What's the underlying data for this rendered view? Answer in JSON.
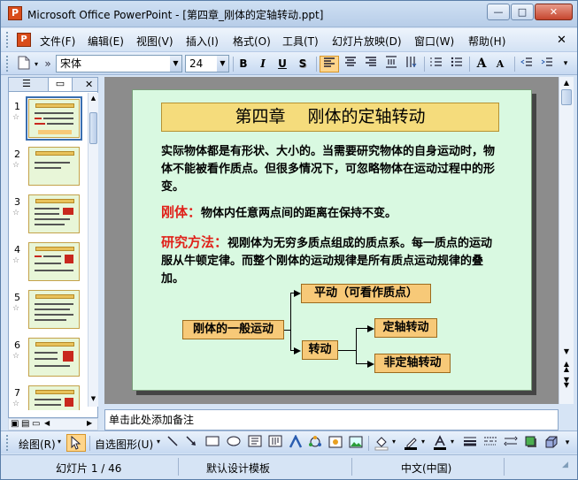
{
  "window": {
    "app_icon": "P",
    "title": "Microsoft Office PowerPoint - [第四章_刚体的定轴转动.ppt]",
    "buttons": {
      "minimize": "—",
      "maximize": "□",
      "close": "✕"
    }
  },
  "menubar": {
    "doc_icon": "P",
    "items": [
      "文件(F)",
      "编辑(E)",
      "视图(V)",
      "插入(I)",
      "格式(O)",
      "工具(T)",
      "幻灯片放映(D)",
      "窗口(W)",
      "帮助(H)"
    ],
    "close_glyph": "✕"
  },
  "toolbar": {
    "font_name": "宋体",
    "font_size": "24",
    "bold": "B",
    "italic": "I",
    "underline": "U",
    "shadow": "S",
    "increase_font": "A",
    "decrease_font": "A"
  },
  "left_pane": {
    "tab_outline_glyph": "☰",
    "tab_slides_glyph": "▭",
    "close_glyph": "✕",
    "thumbnails": [
      {
        "num": "1",
        "star": "☆"
      },
      {
        "num": "2",
        "star": "☆"
      },
      {
        "num": "3",
        "star": "☆"
      },
      {
        "num": "4",
        "star": "☆"
      },
      {
        "num": "5",
        "star": "☆"
      },
      {
        "num": "6",
        "star": "☆"
      },
      {
        "num": "7",
        "star": "☆"
      }
    ]
  },
  "slide": {
    "title": "第四章　 刚体的定轴转动",
    "para1": "实际物体都是有形状、大小的。当需要研究物体的自身运动时，物体不能被看作质点。但很多情况下，可忽略物体在运动过程中的形变。",
    "rigid_label": "刚体：",
    "rigid_def": "物体内任意两点间的距离在保持不变。",
    "method_label": "研究方法：",
    "method_text": "视刚体为无穷多质点组成的质点系。每一质点的运动服从牛顿定律。而整个刚体的运动规律是所有质点运动规律的叠加。",
    "diagram": {
      "root": "刚体的一般运动",
      "translation": "平动（可看作质点）",
      "rotation": "转动",
      "fixed_axis": "定轴转动",
      "non_fixed_axis": "非定轴转动"
    }
  },
  "notes": {
    "placeholder": "单击此处添加备注"
  },
  "drawbar": {
    "draw_label": "绘图(R)",
    "autoshape_label": "自选图形(U)"
  },
  "statusbar": {
    "slide_info": "幻灯片 1 / 46",
    "template": "默认设计模板",
    "language": "中文(中国)"
  },
  "colors": {
    "slide_bg": "#d9f9e1",
    "title_box": "#f5dc7c",
    "diagram_box": "#f7c978",
    "red_text": "#e0211a",
    "canvas_bg": "#8c8c8c"
  }
}
